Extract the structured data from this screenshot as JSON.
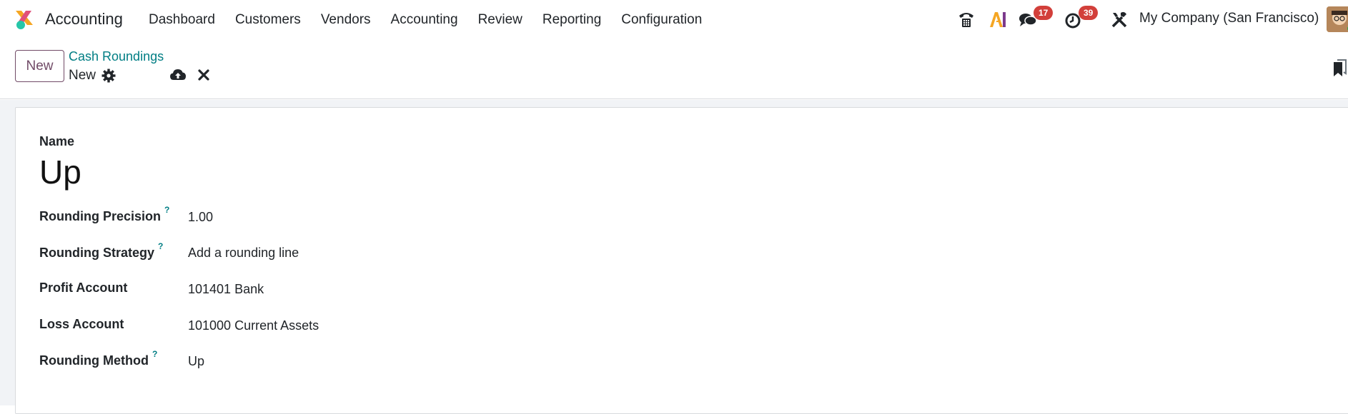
{
  "app": {
    "name": "Accounting",
    "menu": [
      "Dashboard",
      "Customers",
      "Vendors",
      "Accounting",
      "Review",
      "Reporting",
      "Configuration"
    ]
  },
  "systray": {
    "messages_count": "17",
    "activities_count": "39",
    "company": "My Company (San Francisco)",
    "icons": [
      "phone-icon",
      "ai-icon",
      "chat-icon",
      "clock-icon",
      "tools-icon",
      "avatar"
    ]
  },
  "control_panel": {
    "new_button": "New",
    "breadcrumb": "Cash Roundings",
    "record_name": "New"
  },
  "form": {
    "name_label": "Name",
    "name_value": "Up",
    "fields": [
      {
        "label": "Rounding Precision",
        "help": "?",
        "value": "1.00"
      },
      {
        "label": "Rounding Strategy",
        "help": "?",
        "value": "Add a rounding line"
      },
      {
        "label": "Profit Account",
        "help": "",
        "value": "101401 Bank"
      },
      {
        "label": "Loss Account",
        "help": "",
        "value": "101000 Current Assets"
      },
      {
        "label": "Rounding Method",
        "help": "?",
        "value": "Up"
      }
    ]
  },
  "colors": {
    "brand": "#714b67",
    "link": "#017e84",
    "badge": "#d23f3a"
  }
}
